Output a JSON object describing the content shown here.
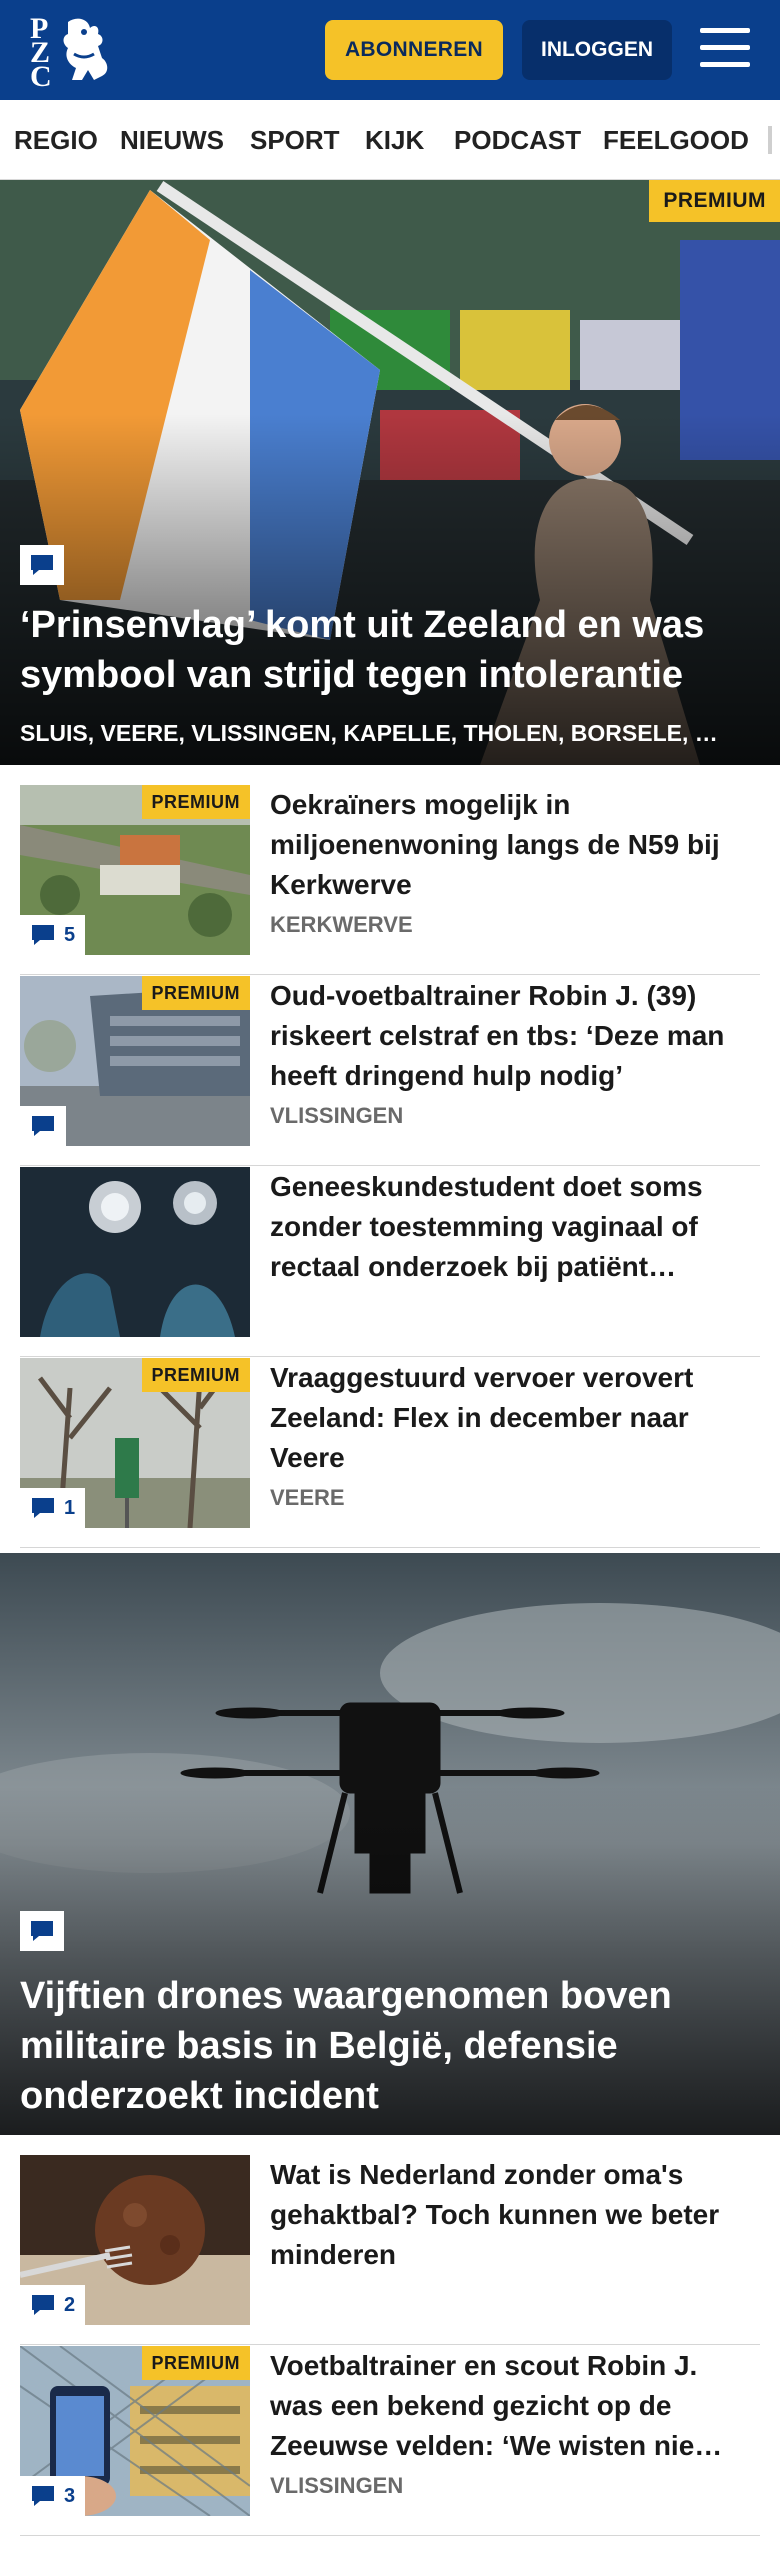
{
  "header": {
    "logo_letters": [
      "P",
      "Z",
      "C"
    ],
    "subscribe_label": "ABONNEREN",
    "login_label": "INLOGGEN",
    "menu_icon": "hamburger-icon"
  },
  "nav": {
    "items": [
      "REGIO",
      "NIEUWS",
      "SPORT",
      "KIJK",
      "PODCAST",
      "FEELGOOD"
    ]
  },
  "hero_main": {
    "premium": "PREMIUM",
    "title": "‘Prinsenvlag’ komt uit Zeeland en was symbool van strijd tegen intolerantie",
    "tags": "SLUIS, VEERE, VLISSINGEN, KAPELLE, THOLEN, BORSELE, …",
    "comment_icon": "comment-icon"
  },
  "articles_top": [
    {
      "premium": "PREMIUM",
      "comments": "5",
      "title": "Oekraïners mogelijk in miljoenenwoning langs de N59 bij Kerkwerve",
      "location": "KERKWERVE"
    },
    {
      "premium": "PREMIUM",
      "comments": "",
      "title": "Oud-voetbaltrainer Robin J. (39) riskeert celstraf en tbs: ‘Deze man heeft dringend hulp nodig’",
      "location": "VLISSINGEN"
    },
    {
      "premium": "",
      "comments": "",
      "title": "Geneeskundestudent doet soms zonder toestemming vaginaal of rectaal onderzoek bij patiënt…",
      "location": ""
    },
    {
      "premium": "PREMIUM",
      "comments": "1",
      "title": "Vraaggestuurd vervoer verovert Zeeland: Flex in december naar Veere",
      "location": "VEERE"
    }
  ],
  "hero_second": {
    "title": "Vijftien drones waargenomen boven militaire basis in België, defensie onderzoekt incident",
    "comment_icon": "comment-icon"
  },
  "articles_bottom": [
    {
      "premium": "",
      "comments": "2",
      "title": "Wat is Nederland zonder oma's gehaktbal? Toch kunnen we beter minderen",
      "location": ""
    },
    {
      "premium": "PREMIUM",
      "comments": "3",
      "title": "Voetbaltrainer en scout Robin J. was een bekend gezicht op de Zeeuwse velden: ‘We wisten nie…",
      "location": "VLISSINGEN"
    }
  ],
  "colors": {
    "brand_blue": "#0a3f8c",
    "accent_yellow": "#f5c228"
  }
}
